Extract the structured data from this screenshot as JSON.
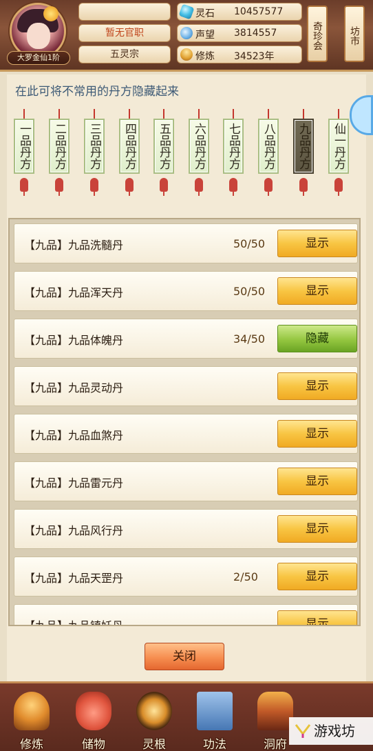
{
  "player": {
    "name": "",
    "rank_title": "大罗金仙1阶",
    "official_post": "暂无官职",
    "sect": "五灵宗"
  },
  "stats": [
    {
      "icon": "spirit-stone-icon",
      "label": "灵石",
      "value": "10457577"
    },
    {
      "icon": "reputation-icon",
      "label": "声望",
      "value": "3814557"
    },
    {
      "icon": "cultivation-icon",
      "label": "修炼",
      "value": "34523年"
    }
  ],
  "side_tabs": [
    {
      "label": "奇珍会"
    },
    {
      "label": "坊市"
    }
  ],
  "panel": {
    "hint": "在此可将不常用的丹方隐藏起来",
    "tags": [
      {
        "label": "一品丹方",
        "active": false
      },
      {
        "label": "二品丹方",
        "active": false
      },
      {
        "label": "三品丹方",
        "active": false
      },
      {
        "label": "四品丹方",
        "active": false
      },
      {
        "label": "五品丹方",
        "active": false
      },
      {
        "label": "六品丹方",
        "active": false
      },
      {
        "label": "七品丹方",
        "active": false
      },
      {
        "label": "八品丹方",
        "active": false
      },
      {
        "label": "九品丹方",
        "active": true
      },
      {
        "label": "仙一丹方",
        "active": false
      }
    ],
    "recipes": [
      {
        "name": "【九品】九品洗髓丹",
        "count": "50/50",
        "action": "显示",
        "state": "show"
      },
      {
        "name": "【九品】九品浑天丹",
        "count": "50/50",
        "action": "显示",
        "state": "show"
      },
      {
        "name": "【九品】九品体魄丹",
        "count": "34/50",
        "action": "隐藏",
        "state": "hide"
      },
      {
        "name": "【九品】九品灵动丹",
        "count": "",
        "action": "显示",
        "state": "show"
      },
      {
        "name": "【九品】九品血煞丹",
        "count": "",
        "action": "显示",
        "state": "show"
      },
      {
        "name": "【九品】九品雷元丹",
        "count": "",
        "action": "显示",
        "state": "show"
      },
      {
        "name": "【九品】九品风行丹",
        "count": "",
        "action": "显示",
        "state": "show"
      },
      {
        "name": "【九品】九品天罡丹",
        "count": "2/50",
        "action": "显示",
        "state": "show"
      },
      {
        "name": "【九品】九品镇妖丹",
        "count": "",
        "action": "显示",
        "state": "show"
      }
    ],
    "close_label": "关闭"
  },
  "bottom_nav": [
    {
      "label": "修炼",
      "icon": "cultivate-icon"
    },
    {
      "label": "储物",
      "icon": "storage-bag-icon"
    },
    {
      "label": "灵根",
      "icon": "spirit-root-icon"
    },
    {
      "label": "功法",
      "icon": "technique-book-icon"
    },
    {
      "label": "洞府",
      "icon": "cave-dwelling-icon"
    }
  ],
  "watermark": "游戏坊"
}
